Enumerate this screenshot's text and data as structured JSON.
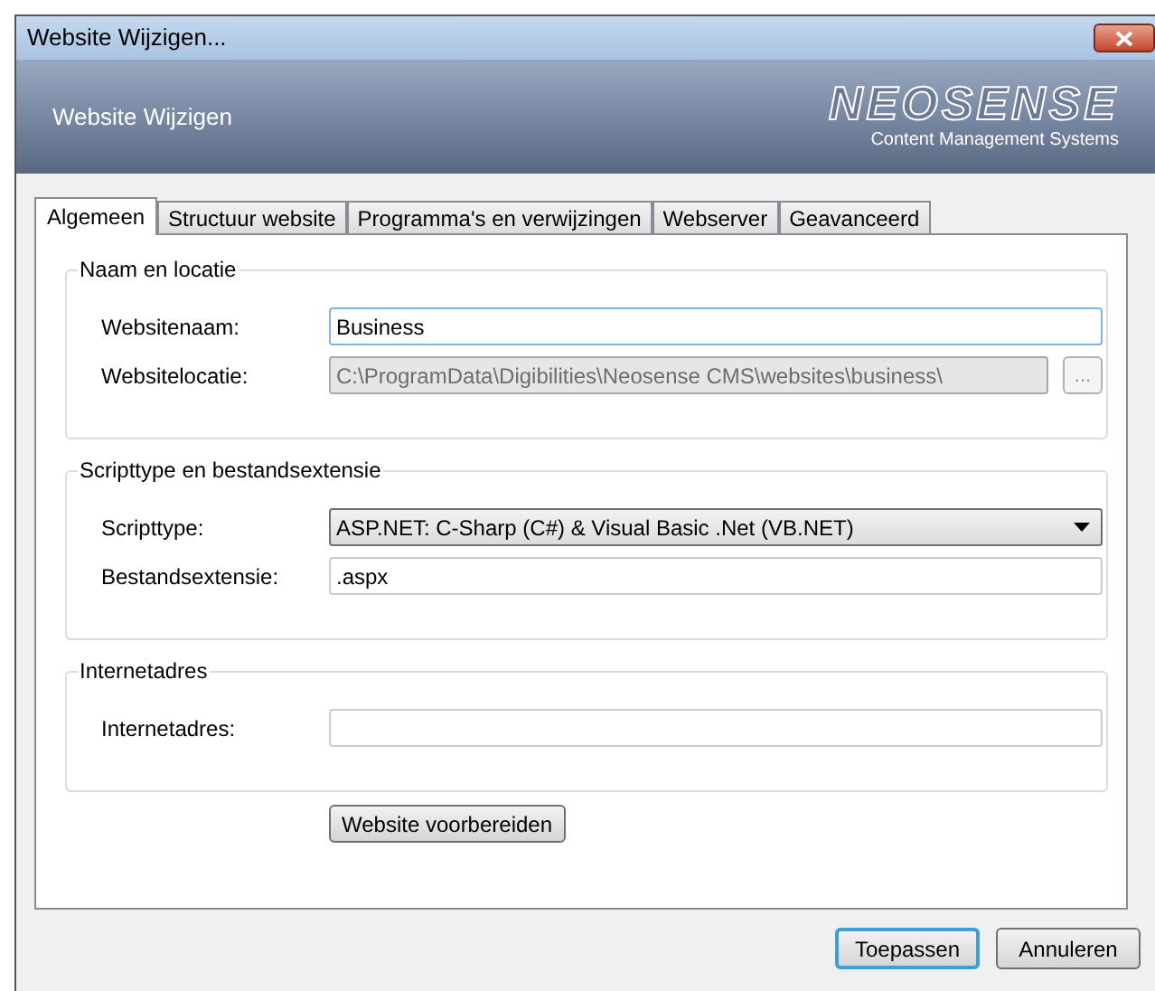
{
  "window": {
    "title": "Website Wijzigen..."
  },
  "header": {
    "title": "Website Wijzigen",
    "logo": "NEOSENSE",
    "tagline": "Content Management Systems"
  },
  "tabs": [
    {
      "label": "Algemeen",
      "selected": true
    },
    {
      "label": "Structuur website",
      "selected": false
    },
    {
      "label": "Programma's en verwijzingen",
      "selected": false
    },
    {
      "label": "Webserver",
      "selected": false
    },
    {
      "label": "Geavanceerd",
      "selected": false
    }
  ],
  "groups": [
    {
      "title": "Naam en locatie",
      "fields": [
        {
          "kind": "text",
          "label": "Websitenaam:",
          "value": "Business",
          "focused": true,
          "disabled": false
        },
        {
          "kind": "text",
          "label": "Websitelocatie:",
          "value": "C:\\ProgramData\\Digibilities\\Neosense CMS\\websites\\business\\",
          "focused": false,
          "disabled": true,
          "browse_button": "..."
        }
      ]
    },
    {
      "title": "Scripttype en bestandsextensie",
      "fields": [
        {
          "kind": "dropdown",
          "label": "Scripttype:",
          "value": "ASP.NET: C-Sharp (C#) & Visual Basic .Net (VB.NET)"
        },
        {
          "kind": "text",
          "label": "Bestandsextensie:",
          "value": ".aspx",
          "focused": false,
          "disabled": false
        }
      ]
    },
    {
      "title": "Internetadres",
      "fields": [
        {
          "kind": "text",
          "label": "Internetadres:",
          "focused": false,
          "disabled": false
        }
      ]
    }
  ],
  "prepare_button": "Website voorbereiden",
  "buttons": [
    {
      "label": "Toepassen",
      "default": true
    },
    {
      "label": "Annuleren",
      "default": false
    }
  ]
}
